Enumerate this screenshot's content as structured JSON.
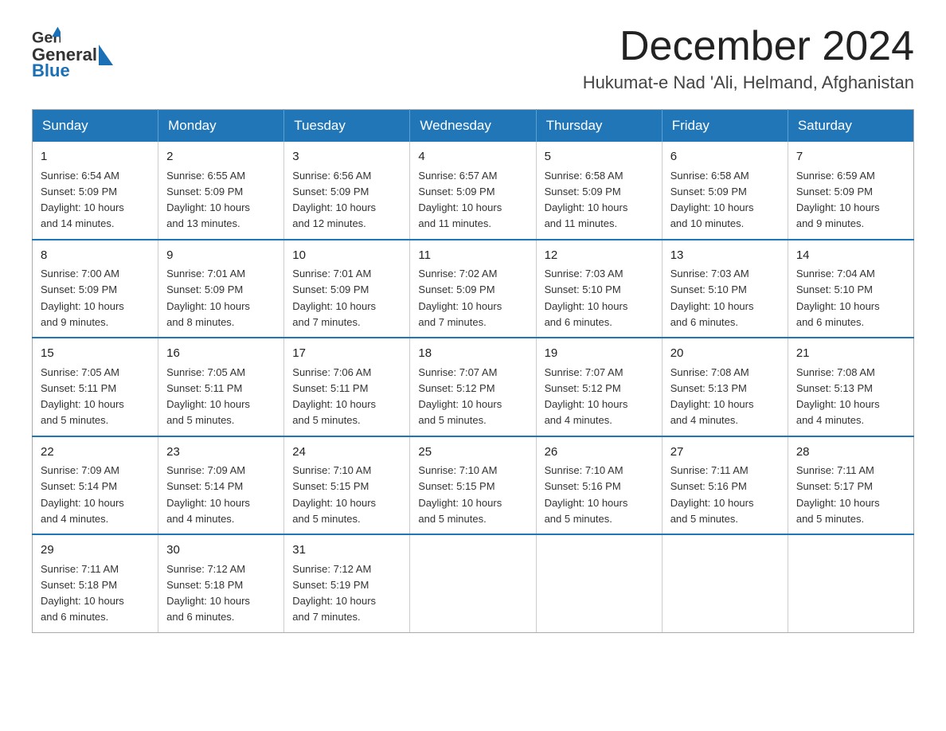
{
  "header": {
    "logo_general": "General",
    "logo_blue": "Blue",
    "month_year": "December 2024",
    "location": "Hukumat-e Nad 'Ali, Helmand, Afghanistan"
  },
  "days_of_week": [
    "Sunday",
    "Monday",
    "Tuesday",
    "Wednesday",
    "Thursday",
    "Friday",
    "Saturday"
  ],
  "weeks": [
    [
      {
        "day": "1",
        "sunrise": "6:54 AM",
        "sunset": "5:09 PM",
        "daylight": "10 hours and 14 minutes."
      },
      {
        "day": "2",
        "sunrise": "6:55 AM",
        "sunset": "5:09 PM",
        "daylight": "10 hours and 13 minutes."
      },
      {
        "day": "3",
        "sunrise": "6:56 AM",
        "sunset": "5:09 PM",
        "daylight": "10 hours and 12 minutes."
      },
      {
        "day": "4",
        "sunrise": "6:57 AM",
        "sunset": "5:09 PM",
        "daylight": "10 hours and 11 minutes."
      },
      {
        "day": "5",
        "sunrise": "6:58 AM",
        "sunset": "5:09 PM",
        "daylight": "10 hours and 11 minutes."
      },
      {
        "day": "6",
        "sunrise": "6:58 AM",
        "sunset": "5:09 PM",
        "daylight": "10 hours and 10 minutes."
      },
      {
        "day": "7",
        "sunrise": "6:59 AM",
        "sunset": "5:09 PM",
        "daylight": "10 hours and 9 minutes."
      }
    ],
    [
      {
        "day": "8",
        "sunrise": "7:00 AM",
        "sunset": "5:09 PM",
        "daylight": "10 hours and 9 minutes."
      },
      {
        "day": "9",
        "sunrise": "7:01 AM",
        "sunset": "5:09 PM",
        "daylight": "10 hours and 8 minutes."
      },
      {
        "day": "10",
        "sunrise": "7:01 AM",
        "sunset": "5:09 PM",
        "daylight": "10 hours and 7 minutes."
      },
      {
        "day": "11",
        "sunrise": "7:02 AM",
        "sunset": "5:09 PM",
        "daylight": "10 hours and 7 minutes."
      },
      {
        "day": "12",
        "sunrise": "7:03 AM",
        "sunset": "5:10 PM",
        "daylight": "10 hours and 6 minutes."
      },
      {
        "day": "13",
        "sunrise": "7:03 AM",
        "sunset": "5:10 PM",
        "daylight": "10 hours and 6 minutes."
      },
      {
        "day": "14",
        "sunrise": "7:04 AM",
        "sunset": "5:10 PM",
        "daylight": "10 hours and 6 minutes."
      }
    ],
    [
      {
        "day": "15",
        "sunrise": "7:05 AM",
        "sunset": "5:11 PM",
        "daylight": "10 hours and 5 minutes."
      },
      {
        "day": "16",
        "sunrise": "7:05 AM",
        "sunset": "5:11 PM",
        "daylight": "10 hours and 5 minutes."
      },
      {
        "day": "17",
        "sunrise": "7:06 AM",
        "sunset": "5:11 PM",
        "daylight": "10 hours and 5 minutes."
      },
      {
        "day": "18",
        "sunrise": "7:07 AM",
        "sunset": "5:12 PM",
        "daylight": "10 hours and 5 minutes."
      },
      {
        "day": "19",
        "sunrise": "7:07 AM",
        "sunset": "5:12 PM",
        "daylight": "10 hours and 4 minutes."
      },
      {
        "day": "20",
        "sunrise": "7:08 AM",
        "sunset": "5:13 PM",
        "daylight": "10 hours and 4 minutes."
      },
      {
        "day": "21",
        "sunrise": "7:08 AM",
        "sunset": "5:13 PM",
        "daylight": "10 hours and 4 minutes."
      }
    ],
    [
      {
        "day": "22",
        "sunrise": "7:09 AM",
        "sunset": "5:14 PM",
        "daylight": "10 hours and 4 minutes."
      },
      {
        "day": "23",
        "sunrise": "7:09 AM",
        "sunset": "5:14 PM",
        "daylight": "10 hours and 4 minutes."
      },
      {
        "day": "24",
        "sunrise": "7:10 AM",
        "sunset": "5:15 PM",
        "daylight": "10 hours and 5 minutes."
      },
      {
        "day": "25",
        "sunrise": "7:10 AM",
        "sunset": "5:15 PM",
        "daylight": "10 hours and 5 minutes."
      },
      {
        "day": "26",
        "sunrise": "7:10 AM",
        "sunset": "5:16 PM",
        "daylight": "10 hours and 5 minutes."
      },
      {
        "day": "27",
        "sunrise": "7:11 AM",
        "sunset": "5:16 PM",
        "daylight": "10 hours and 5 minutes."
      },
      {
        "day": "28",
        "sunrise": "7:11 AM",
        "sunset": "5:17 PM",
        "daylight": "10 hours and 5 minutes."
      }
    ],
    [
      {
        "day": "29",
        "sunrise": "7:11 AM",
        "sunset": "5:18 PM",
        "daylight": "10 hours and 6 minutes."
      },
      {
        "day": "30",
        "sunrise": "7:12 AM",
        "sunset": "5:18 PM",
        "daylight": "10 hours and 6 minutes."
      },
      {
        "day": "31",
        "sunrise": "7:12 AM",
        "sunset": "5:19 PM",
        "daylight": "10 hours and 7 minutes."
      },
      null,
      null,
      null,
      null
    ]
  ]
}
